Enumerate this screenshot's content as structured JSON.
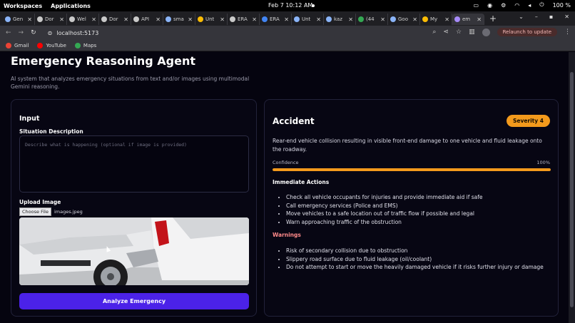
{
  "os": {
    "workspaces": "Workspaces",
    "applications": "Applications",
    "clock": "Feb 7  10:12 AM",
    "battery": "100 %"
  },
  "tabs": [
    {
      "label": "Gen",
      "color": "#8ab4f8"
    },
    {
      "label": "Dor",
      "color": "#c9c9c9"
    },
    {
      "label": "Wel",
      "color": "#c9c9c9"
    },
    {
      "label": "Dor",
      "color": "#c9c9c9"
    },
    {
      "label": "API",
      "color": "#c9c9c9"
    },
    {
      "label": "sma",
      "color": "#8ab4f8"
    },
    {
      "label": "Unt",
      "color": "#fbbc04"
    },
    {
      "label": "ERA",
      "color": "#c9c9c9"
    },
    {
      "label": "ERA",
      "color": "#4285f4"
    },
    {
      "label": "Unt",
      "color": "#8ab4f8"
    },
    {
      "label": "kaz",
      "color": "#8ab4f8"
    },
    {
      "label": "(44",
      "color": "#34a853"
    },
    {
      "label": "Goo",
      "color": "#8ab4f8"
    },
    {
      "label": "My",
      "color": "#fbbc04"
    },
    {
      "label": "em",
      "color": "#a78bfa"
    }
  ],
  "browser": {
    "url": "localhost:5173",
    "relaunch": "Relaunch to update"
  },
  "bookmarks": [
    {
      "label": "Gmail",
      "color": "#ea4335"
    },
    {
      "label": "YouTube",
      "color": "#ff0000"
    },
    {
      "label": "Maps",
      "color": "#34a853"
    }
  ],
  "page": {
    "title": "Emergency Reasoning Agent",
    "subtitle": "AI system that analyzes emergency situations from text and/or images using multimodal Gemini reasoning."
  },
  "input": {
    "title": "Input",
    "situation_label": "Situation Description",
    "situation_placeholder": "Describe what is happening (optional if image is provided)",
    "upload_label": "Upload Image",
    "choose_file": "Choose File",
    "file_name": "images.jpeg",
    "analyze_button": "Analyze Emergency"
  },
  "result": {
    "title": "Accident",
    "severity": "Severity 4",
    "description": "Rear-end vehicle collision resulting in visible front-end damage to one vehicle and fluid leakage onto the roadway.",
    "confidence_label": "Confidence",
    "confidence_text": "100%",
    "confidence_value": 1.0,
    "actions_title": "Immediate Actions",
    "actions": [
      "Check all vehicle occupants for injuries and provide immediate aid if safe",
      "Call emergency services (Police and EMS)",
      "Move vehicles to a safe location out of traffic flow if possible and legal",
      "Warn approaching traffic of the obstruction"
    ],
    "warnings_title": "Warnings",
    "warnings": [
      "Risk of secondary collision due to obstruction",
      "Slippery road surface due to fluid leakage (oil/coolant)",
      "Do not attempt to start or move the heavily damaged vehicle if it risks further injury or damage"
    ]
  },
  "colors": {
    "accent": "#4b22e8",
    "severity": "#f39a1c",
    "warning": "#ff8a8a"
  }
}
